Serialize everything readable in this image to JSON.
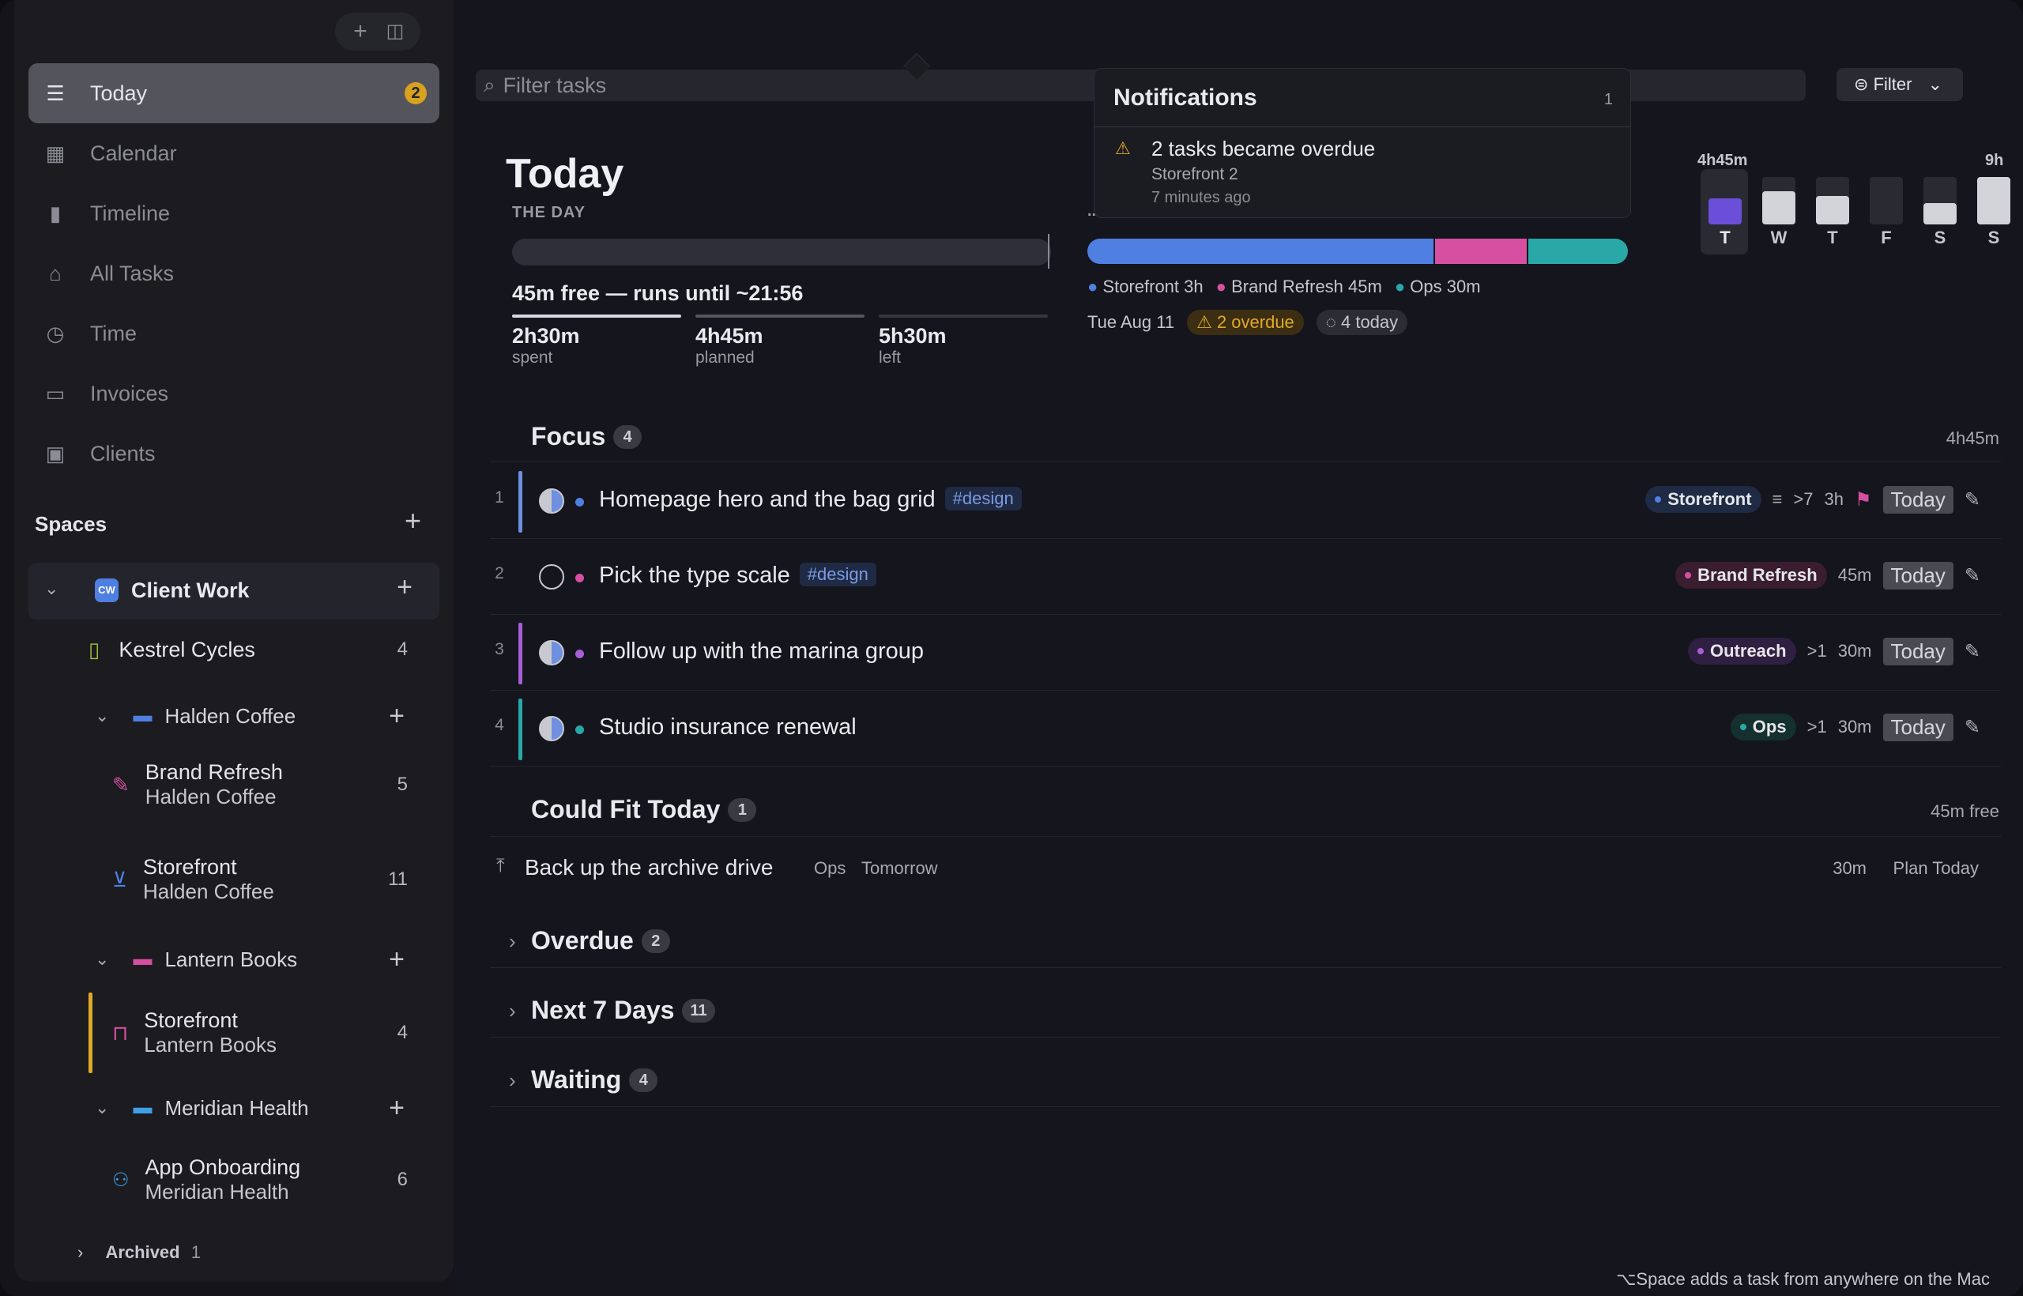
{
  "sidebar": {
    "nav": [
      {
        "label": "Today",
        "badge": "2",
        "icon": "today-list-icon"
      },
      {
        "label": "Calendar",
        "icon": "calendar-icon"
      },
      {
        "label": "Timeline",
        "icon": "timeline-icon"
      },
      {
        "label": "All Tasks",
        "icon": "inbox-icon"
      },
      {
        "label": "Time",
        "icon": "clock-icon"
      },
      {
        "label": "Invoices",
        "icon": "invoice-icon"
      },
      {
        "label": "Clients",
        "icon": "clients-icon"
      }
    ],
    "spaces_label": "Spaces",
    "client_work": {
      "label": "Client Work",
      "avatar": "CW"
    },
    "items": [
      {
        "title": "Kestrel Cycles",
        "count": "4"
      },
      {
        "folder": "Halden Coffee"
      },
      {
        "title": "Brand Refresh",
        "sub": "Halden Coffee",
        "count": "5"
      },
      {
        "title": "Storefront",
        "sub": "Halden Coffee",
        "count": "11"
      },
      {
        "folder": "Lantern Books"
      },
      {
        "title": "Storefront",
        "sub": "Lantern Books",
        "count": "4"
      },
      {
        "folder": "Meridian Health"
      },
      {
        "title": "App Onboarding",
        "sub": "Meridian Health",
        "count": "6"
      }
    ],
    "archived": {
      "label": "Archived",
      "count": "1"
    }
  },
  "toolbar": {
    "filter_placeholder": "Filter tasks",
    "filter_button": "Filter"
  },
  "notifications": {
    "title": "Notifications",
    "count": "1",
    "item": {
      "title": "2 tasks became overdue",
      "sub": "Storefront 2",
      "time": "7 minutes ago"
    }
  },
  "header": {
    "title": "Today",
    "the_day": "THE DAY",
    "free_text": "45m free — runs until ~21:56",
    "stats": [
      {
        "value": "2h30m",
        "label": "spent"
      },
      {
        "value": "4h45m",
        "label": "planned"
      },
      {
        "value": "5h30m",
        "label": "left"
      }
    ],
    "plan_partial_label": ".. .D",
    "legend": [
      {
        "name": "Storefront",
        "dur": "3h",
        "color": "#4f7fe0"
      },
      {
        "name": "Brand Refresh",
        "dur": "45m",
        "color": "#d64fa0"
      },
      {
        "name": "Ops",
        "dur": "30m",
        "color": "#2aa7a7"
      }
    ],
    "date": "Tue Aug 11",
    "overdue_badge": "2 overdue",
    "today_badge": "4 today"
  },
  "week": {
    "top_left": "4h45m",
    "top_right": "9h",
    "days": [
      "T",
      "W",
      "T",
      "F",
      "S",
      "S"
    ],
    "fill": [
      0.55,
      0.7,
      0.6,
      0,
      0.45,
      1.0
    ]
  },
  "focus": {
    "label": "Focus",
    "count": "4",
    "total": "4h45m",
    "tasks": [
      {
        "num": "1",
        "title": "Homepage hero and the bag grid",
        "tag": "#design",
        "project": "Storefront",
        "proj_color": "#4f7fe0",
        "sub": "7",
        "dur": "3h",
        "today": "Today",
        "bar": "#6f8fdf",
        "dot": "#4f7fe0"
      },
      {
        "num": "2",
        "title": "Pick the type scale",
        "tag": "#design",
        "project": "Brand Refresh",
        "proj_color": "#d64fa0",
        "dur": "45m",
        "today": "Today",
        "dot": "#d64fa0"
      },
      {
        "num": "3",
        "title": "Follow up with the marina group",
        "project": "Outreach",
        "proj_color": "#a65fd6",
        "sub": "1",
        "dur": "30m",
        "today": "Today",
        "bar": "#a65fd6",
        "dot": "#a65fd6"
      },
      {
        "num": "4",
        "title": "Studio insurance renewal",
        "project": "Ops",
        "proj_color": "#2aa7a7",
        "sub": "1",
        "dur": "30m",
        "today": "Today",
        "bar": "#2aa7a7",
        "dot": "#2aa7a7"
      }
    ]
  },
  "could_fit": {
    "label": "Could Fit Today",
    "count": "1",
    "free": "45m free",
    "item": {
      "title": "Back up the archive drive",
      "project": "Ops",
      "when": "Tomorrow",
      "dur": "30m",
      "action": "Plan Today"
    }
  },
  "sections": [
    {
      "label": "Overdue",
      "count": "2"
    },
    {
      "label": "Next 7 Days",
      "count": "11"
    },
    {
      "label": "Waiting",
      "count": "4"
    }
  ],
  "footer_hint": "⌥Space adds a task from anywhere on the Mac"
}
